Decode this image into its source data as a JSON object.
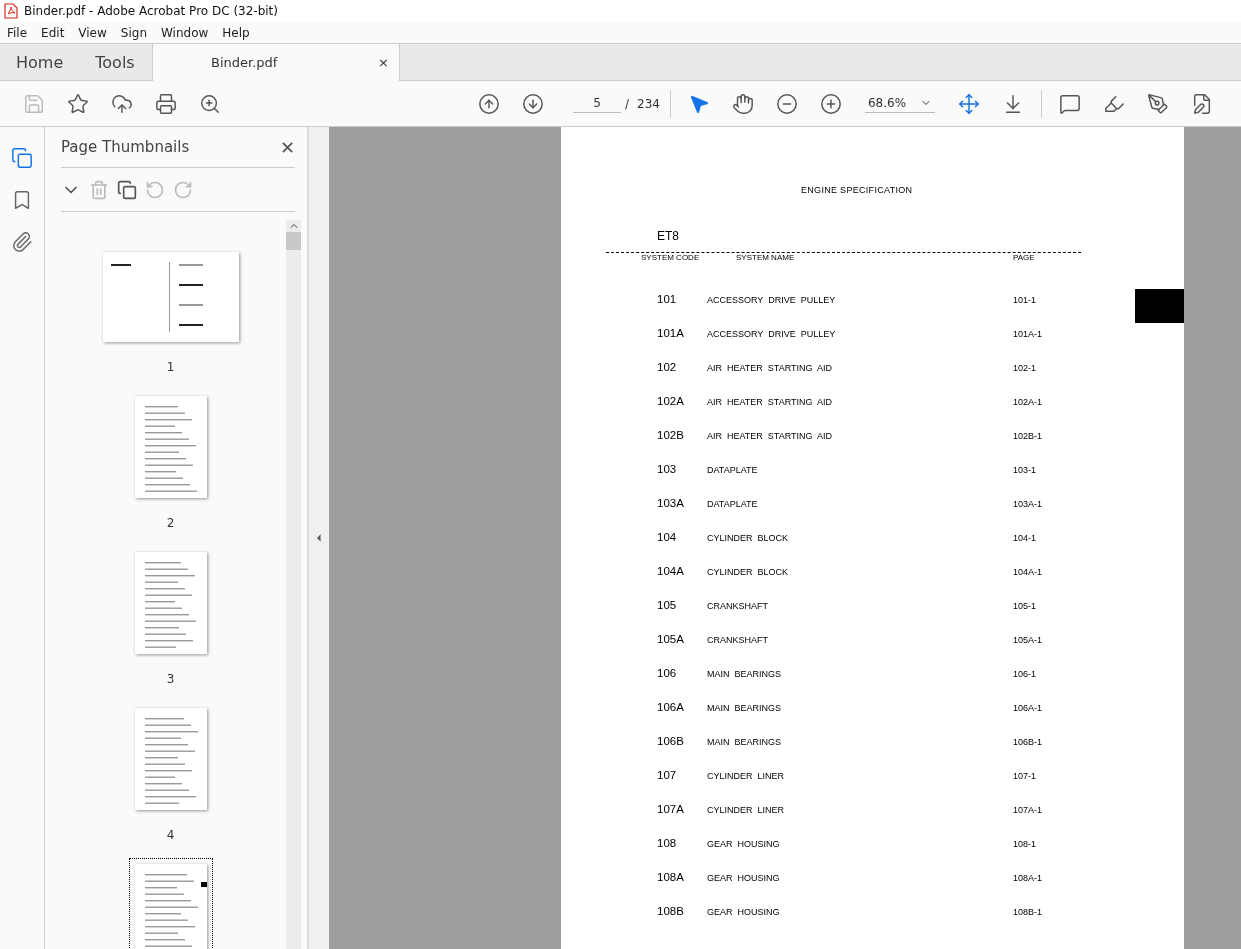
{
  "window": {
    "title": "Binder.pdf - Adobe Acrobat Pro DC (32-bit)"
  },
  "menu": [
    "File",
    "Edit",
    "View",
    "Sign",
    "Window",
    "Help"
  ],
  "nav_tabs": [
    {
      "label": "Home",
      "selected": false
    },
    {
      "label": "Tools",
      "selected": false
    }
  ],
  "document_tab": {
    "label": "Binder.pdf",
    "close": "×",
    "selected": true
  },
  "toolbar": {
    "page_number": "5",
    "page_separator": "/",
    "page_count": "234",
    "zoom": "68.6%"
  },
  "side_rail": [
    {
      "kind": "pages",
      "selected": true
    },
    {
      "kind": "bookmarks",
      "selected": false
    },
    {
      "kind": "attachments",
      "selected": false
    }
  ],
  "thumbnails_panel": {
    "title": "Page Thumbnails",
    "close": "✕",
    "thumbnails": [
      {
        "label": "1",
        "kind": "landscape",
        "selected": false
      },
      {
        "label": "2",
        "kind": "portrait",
        "selected": false
      },
      {
        "label": "3",
        "kind": "portrait",
        "selected": false
      },
      {
        "label": "4",
        "kind": "portrait",
        "selected": false
      },
      {
        "kind": "portrait",
        "selected": true
      }
    ]
  },
  "page": {
    "heading": "ENGINE SPECIFICATION",
    "model": "ET8",
    "columns": [
      "SYSTEM CODE",
      "SYSTEM NAME",
      "PAGE"
    ],
    "rows": [
      {
        "code": "101",
        "name": "ACCESSORY  DRIVE  PULLEY",
        "page": "101-1"
      },
      {
        "code": "101A",
        "name": "ACCESSORY  DRIVE  PULLEY",
        "page": "101A-1"
      },
      {
        "code": "102",
        "name": "AIR  HEATER  STARTING  AID",
        "page": "102-1"
      },
      {
        "code": "102A",
        "name": "AIR  HEATER  STARTING  AID",
        "page": "102A-1"
      },
      {
        "code": "102B",
        "name": "AIR  HEATER  STARTING  AID",
        "page": "102B-1"
      },
      {
        "code": "103",
        "name": "DATAPLATE",
        "page": "103-1"
      },
      {
        "code": "103A",
        "name": "DATAPLATE",
        "page": "103A-1"
      },
      {
        "code": "104",
        "name": "CYLINDER  BLOCK",
        "page": "104-1"
      },
      {
        "code": "104A",
        "name": "CYLINDER  BLOCK",
        "page": "104A-1"
      },
      {
        "code": "105",
        "name": "CRANKSHAFT",
        "page": "105-1"
      },
      {
        "code": "105A",
        "name": "CRANKSHAFT",
        "page": "105A-1"
      },
      {
        "code": "106",
        "name": "MAIN  BEARINGS",
        "page": "106-1"
      },
      {
        "code": "106A",
        "name": "MAIN  BEARINGS",
        "page": "106A-1"
      },
      {
        "code": "106B",
        "name": "MAIN  BEARINGS",
        "page": "106B-1"
      },
      {
        "code": "107",
        "name": "CYLINDER  LINER",
        "page": "107-1"
      },
      {
        "code": "107A",
        "name": "CYLINDER  LINER",
        "page": "107A-1"
      },
      {
        "code": "108",
        "name": "GEAR  HOUSING",
        "page": "108-1"
      },
      {
        "code": "108A",
        "name": "GEAR  HOUSING",
        "page": "108A-1"
      },
      {
        "code": "108B",
        "name": "GEAR  HOUSING",
        "page": "108B-1"
      }
    ]
  }
}
